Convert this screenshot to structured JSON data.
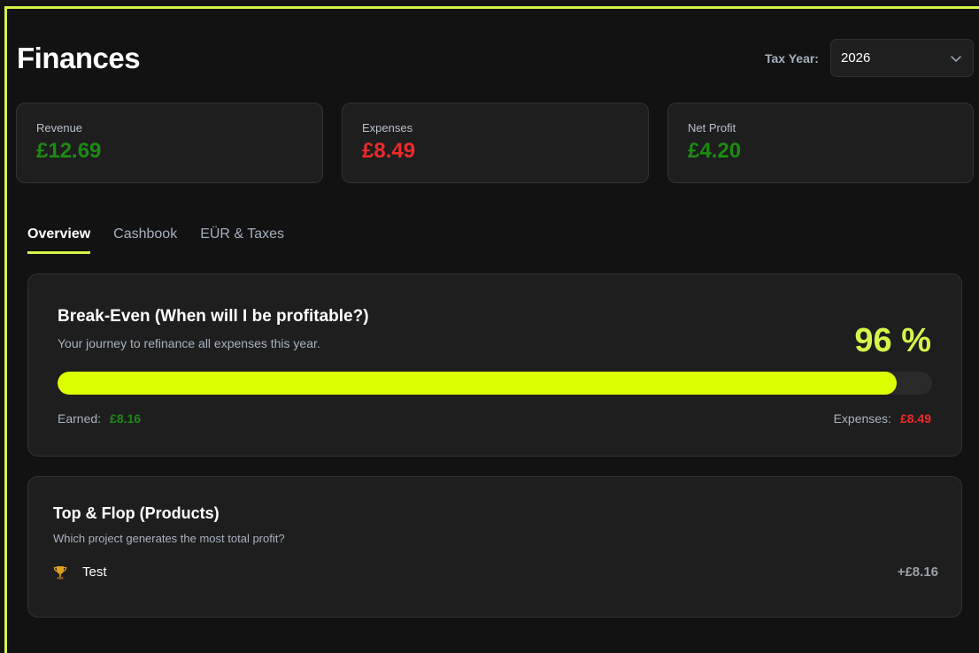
{
  "header": {
    "title": "Finances",
    "tax_year_label": "Tax Year:",
    "tax_year_value": "2026"
  },
  "stats": [
    {
      "label": "Revenue",
      "value": "£12.69",
      "color": "#1c8a12"
    },
    {
      "label": "Expenses",
      "value": "£8.49",
      "color": "#ee2a2a"
    },
    {
      "label": "Net Profit",
      "value": "£4.20",
      "color": "#1c8a12"
    }
  ],
  "tabs": [
    {
      "label": "Overview",
      "active": true
    },
    {
      "label": "Cashbook",
      "active": false
    },
    {
      "label": "EÜR & Taxes",
      "active": false
    }
  ],
  "break_even": {
    "title": "Break-Even (When will I be profitable?)",
    "subtitle": "Your journey to refinance all expenses this year.",
    "percent_label": "96 %",
    "progress": 0.96,
    "earned_label": "Earned:",
    "earned_value": "£8.16",
    "expenses_label": "Expenses:",
    "expenses_value": "£8.49"
  },
  "top_flop": {
    "title": "Top & Flop (Products)",
    "subtitle": "Which project generates the most total profit?",
    "items": [
      {
        "icon": "trophy-icon",
        "name": "Test",
        "value": "+£8.16"
      }
    ]
  },
  "colors": {
    "accent": "#d4f54a",
    "progress_fill": "#dcff02",
    "positive": "#1c8a12",
    "negative": "#ee2a2a",
    "background": "#121212",
    "card": "#1e1e1e"
  }
}
